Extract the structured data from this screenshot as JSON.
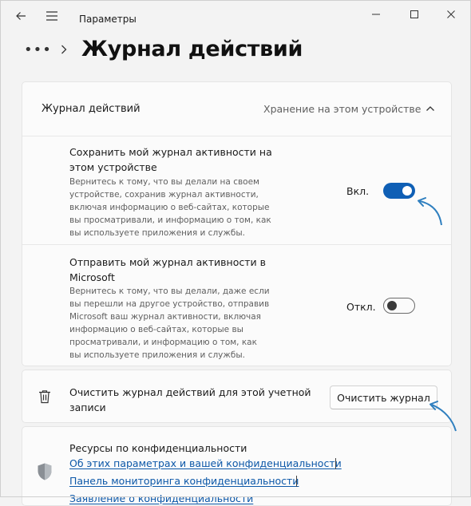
{
  "app": {
    "title": "Параметры"
  },
  "header": {
    "dots": "•••",
    "page_title": "Журнал действий"
  },
  "activity_section": {
    "title": "Журнал действий",
    "subtitle": "Хранение на этом устройстве",
    "store_row": {
      "title": "Сохранить мой журнал активности на\nэтом устройстве",
      "description": "Вернитесь к тому, что вы делали на своем\nустройстве, сохранив журнал активности,\nвключая информацию о веб-сайтах, которые\nвы просматривали, и информацию о том, как\nвы используете приложения и службы.",
      "toggle_label": "Вкл.",
      "toggle_state": true
    },
    "send_row": {
      "title": "Отправить мой журнал активности в\nMicrosoft",
      "description": "Вернитесь к тому, что вы делали, даже если\nвы перешли на другое устройство, отправив\nMicrosoft ваш журнал активности, включая\nинформацию о веб-сайтах, которые вы\nпросматривали, и информацию о том, как\nвы используете приложения и службы.",
      "toggle_label": "Откл.",
      "toggle_state": false
    }
  },
  "clear_section": {
    "icon": "trash-icon",
    "title": "Очистить журнал действий для этой учетной\nзаписи",
    "button_label": "Очистить журнал"
  },
  "privacy_section": {
    "icon": "shield-icon",
    "title": "Ресурсы по конфиденциальности",
    "links": [
      "Об этих параметрах и вашей конфиденциальности",
      "Панель мониторинга конфиденциальности",
      "Заявление о конфиденциальности"
    ]
  },
  "colors": {
    "accent": "#0f5fb5",
    "link": "#0b57a8",
    "annotation_arrow": "#2f7fbf"
  }
}
